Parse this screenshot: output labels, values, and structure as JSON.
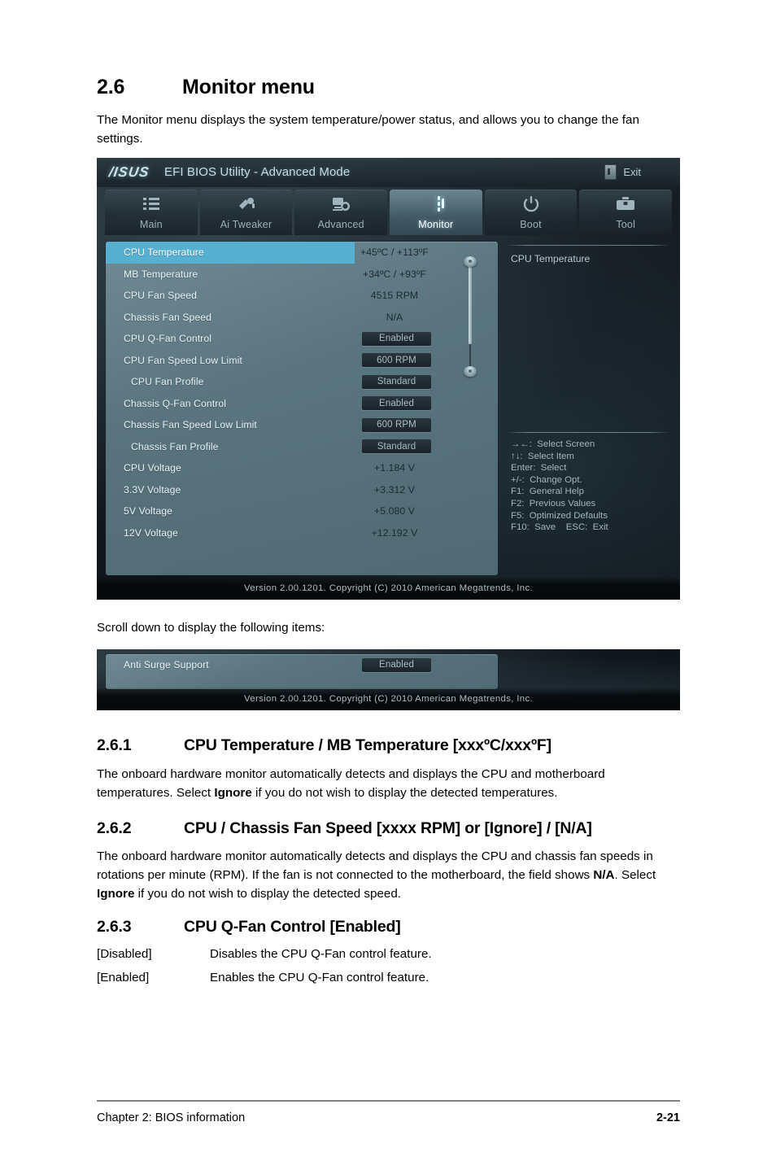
{
  "document": {
    "section": {
      "num": "2.6",
      "title": "Monitor menu"
    },
    "intro": "The Monitor menu displays the system temperature/power status, and allows you to change the fan settings.",
    "scroll_note": "Scroll down to display the following items:",
    "sub_sections": [
      {
        "num": "2.6.1",
        "title": "CPU Temperature / MB Temperature [xxxºC/xxxºF]",
        "body_a": "The onboard hardware monitor automatically detects and displays the CPU and motherboard temperatures. Select ",
        "body_bold": "Ignore",
        "body_b": " if you do not wish to display the detected temperatures."
      },
      {
        "num": "2.6.2",
        "title": "CPU / Chassis Fan Speed [xxxx RPM] or [Ignore] / [N/A]",
        "body_a": "The onboard hardware monitor automatically detects and displays the CPU and chassis fan speeds in rotations per minute (RPM). If the fan is not connected to the motherboard, the field shows ",
        "body_bold": "N/A",
        "body_mid": ". Select ",
        "body_bold2": "Ignore",
        "body_b": " if you do not wish to display the detected speed."
      },
      {
        "num": "2.6.3",
        "title": "CPU Q-Fan Control [Enabled]",
        "definitions": [
          {
            "term": "[Disabled]",
            "desc": "Disables the CPU Q-Fan control feature."
          },
          {
            "term": "[Enabled]",
            "desc": "Enables the CPU Q-Fan control feature."
          }
        ]
      }
    ],
    "footer": {
      "left": "Chapter 2: BIOS information",
      "right": "2-21"
    }
  },
  "bios": {
    "brand": "/ISUS",
    "title": "EFI BIOS Utility - Advanced Mode",
    "exit_label": "Exit",
    "tabs": [
      {
        "label": "Main",
        "icon": "list-icon",
        "active": false
      },
      {
        "label": "Ai  Tweaker",
        "icon": "tuner-icon",
        "active": false
      },
      {
        "label": "Advanced",
        "icon": "advanced-icon",
        "active": false
      },
      {
        "label": "Monitor",
        "icon": "monitor-fan-icon",
        "active": true
      },
      {
        "label": "Boot",
        "icon": "power-icon",
        "active": false
      },
      {
        "label": "Tool",
        "icon": "toolbox-icon",
        "active": false
      }
    ],
    "items": [
      {
        "label": "CPU Temperature",
        "value": "+45ºC / +113ºF",
        "type": "value",
        "selected": true,
        "indent": false
      },
      {
        "label": "MB Temperature",
        "value": "+34ºC / +93ºF",
        "type": "value",
        "selected": false,
        "indent": false
      },
      {
        "label": "CPU Fan Speed",
        "value": "4515 RPM",
        "type": "value",
        "selected": false,
        "indent": false
      },
      {
        "label": "Chassis Fan Speed",
        "value": "N/A",
        "type": "value",
        "selected": false,
        "indent": false
      },
      {
        "label": "CPU Q-Fan Control",
        "value": "Enabled",
        "type": "button",
        "selected": false,
        "indent": false
      },
      {
        "label": "CPU Fan Speed Low Limit",
        "value": "600 RPM",
        "type": "button",
        "selected": false,
        "indent": false
      },
      {
        "label": "CPU Fan Profile",
        "value": "Standard",
        "type": "button",
        "selected": false,
        "indent": true
      },
      {
        "label": "Chassis Q-Fan Control",
        "value": "Enabled",
        "type": "button",
        "selected": false,
        "indent": false
      },
      {
        "label": "Chassis Fan Speed Low Limit",
        "value": "600 RPM",
        "type": "button",
        "selected": false,
        "indent": false
      },
      {
        "label": "Chassis Fan Profile",
        "value": "Standard",
        "type": "button",
        "selected": false,
        "indent": true
      },
      {
        "label": "CPU Voltage",
        "value": "+1.184 V",
        "type": "value",
        "selected": false,
        "indent": false
      },
      {
        "label": "3.3V Voltage",
        "value": "+3.312 V",
        "type": "value",
        "selected": false,
        "indent": false
      },
      {
        "label": "5V Voltage",
        "value": "+5.080 V",
        "type": "value",
        "selected": false,
        "indent": false
      },
      {
        "label": "12V Voltage",
        "value": "+12.192 V",
        "type": "value",
        "selected": false,
        "indent": false
      }
    ],
    "help": {
      "description": "CPU Temperature",
      "keys": "→←:  Select Screen\n↑↓:  Select Item\nEnter:  Select\n+/-:  Change Opt.\nF1:  General Help\nF2:  Previous Values\nF5:  Optimized Defaults\nF10:  Save    ESC:  Exit"
    },
    "version": "Version  2.00.1201.   Copyright  (C)  2010  American  Megatrends,  Inc.",
    "scroll_items": [
      {
        "label": "Anti Surge Support",
        "value": "Enabled",
        "type": "button",
        "selected": false,
        "indent": false
      }
    ],
    "colors": {
      "selected_row": "#56b0d2",
      "panel": "#5e7b85",
      "accent_text": "#c6dce6"
    }
  }
}
